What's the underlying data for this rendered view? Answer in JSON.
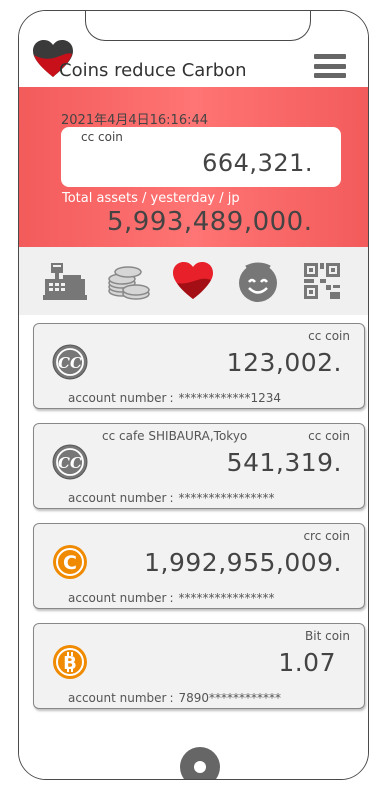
{
  "app": {
    "title": "Coins reduce Carbon",
    "title_rest": "oins reduce Carbon"
  },
  "banner": {
    "datetime": "2021年4月4日16:16:44",
    "coin_label": "cc coin",
    "coin_value": "664,321.",
    "caption": "Total assets / yesterday / jp",
    "total": "5,993,489,000.",
    "colors": {
      "background": "#f35b5b",
      "box": "#ffffff"
    }
  },
  "iconbar": {
    "items": [
      {
        "icon": "cash-register-icon"
      },
      {
        "icon": "coins-stack-icon"
      },
      {
        "icon": "heart-icon"
      },
      {
        "icon": "smiley-icon"
      },
      {
        "icon": "qr-code-icon"
      }
    ]
  },
  "accounts": [
    {
      "icon": "cc-coin-icon",
      "coin_name": "cc coin",
      "store": "",
      "balance": "123,002.",
      "account_label": "account number",
      "account_sep": ":",
      "account_number": "************1234"
    },
    {
      "icon": "cc-coin-icon",
      "coin_name": "cc coin",
      "store": "cc cafe SHIBAURA,Tokyo",
      "balance": "541,319.",
      "account_label": "account number",
      "account_sep": ":",
      "account_number": "****************"
    },
    {
      "icon": "crc-coin-icon",
      "coin_name": "crc coin",
      "store": "",
      "balance": "1,992,955,009.",
      "account_label": "account number",
      "account_sep": ":",
      "account_number": "****************"
    },
    {
      "icon": "bitcoin-icon",
      "coin_name": "Bit coin",
      "store": "",
      "balance": "1.07",
      "account_label": "account number",
      "account_sep": ":",
      "account_number": "7890************"
    }
  ],
  "colors": {
    "accent_red": "#e8202a",
    "crc_orange": "#f08a00",
    "icon_gray": "#777777"
  }
}
